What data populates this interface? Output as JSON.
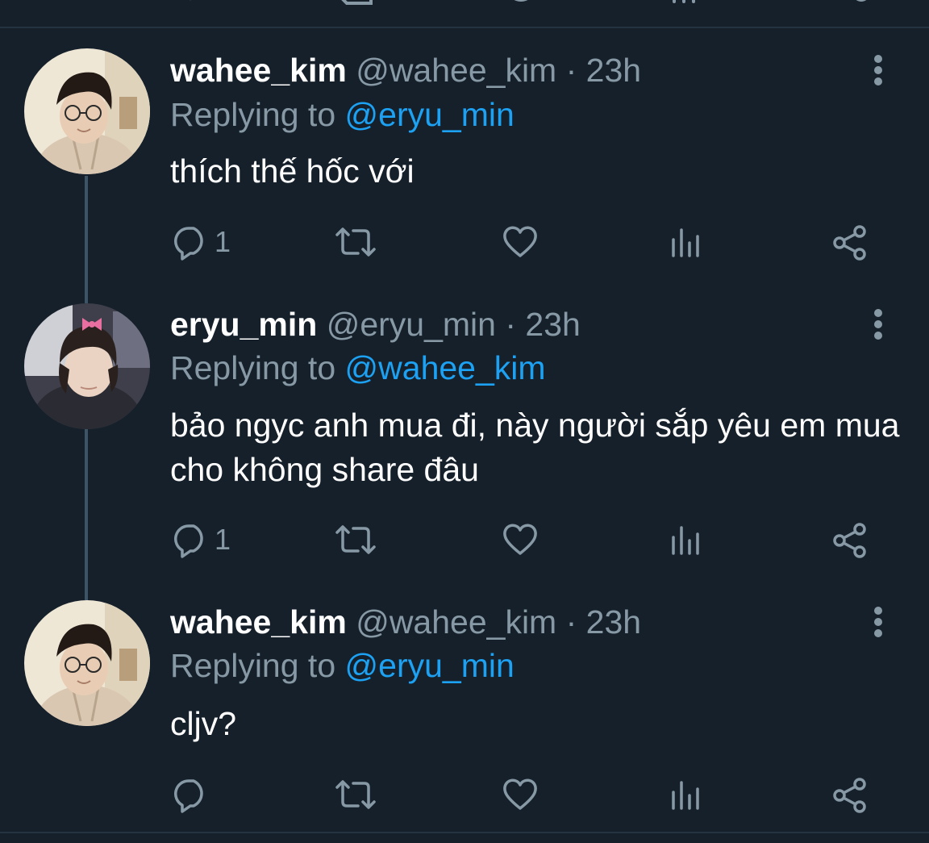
{
  "colors": {
    "background": "#15202b",
    "primary_text": "#ffffff",
    "secondary_text": "#8899a6",
    "accent": "#1da1f2",
    "divider": "#253341",
    "thread_line": "#3d5466"
  },
  "tweets": [
    {
      "display_name": "wahee_kim",
      "handle_time": "@wahee_kim · 23h",
      "replying_prefix": "Replying to",
      "replying_handle": "@eryu_min",
      "text": "thích thế hốc với",
      "reply_count": "1",
      "avatar": "profile-photo-wahee"
    },
    {
      "display_name": "eryu_min",
      "handle_time": "@eryu_min · 23h",
      "replying_prefix": "Replying to",
      "replying_handle": "@wahee_kim",
      "text": "bảo ngyc anh mua đi, này người sắp yêu em mua cho không share đâu",
      "reply_count": "1",
      "avatar": "profile-photo-eryu"
    },
    {
      "display_name": "wahee_kim",
      "handle_time": "@wahee_kim · 23h",
      "replying_prefix": "Replying to",
      "replying_handle": "@eryu_min",
      "text": "cljv?",
      "reply_count": "",
      "avatar": "profile-photo-wahee"
    }
  ],
  "icons": [
    "reply-icon",
    "retweet-icon",
    "like-icon",
    "analytics-icon",
    "share-icon",
    "more-options-icon"
  ]
}
